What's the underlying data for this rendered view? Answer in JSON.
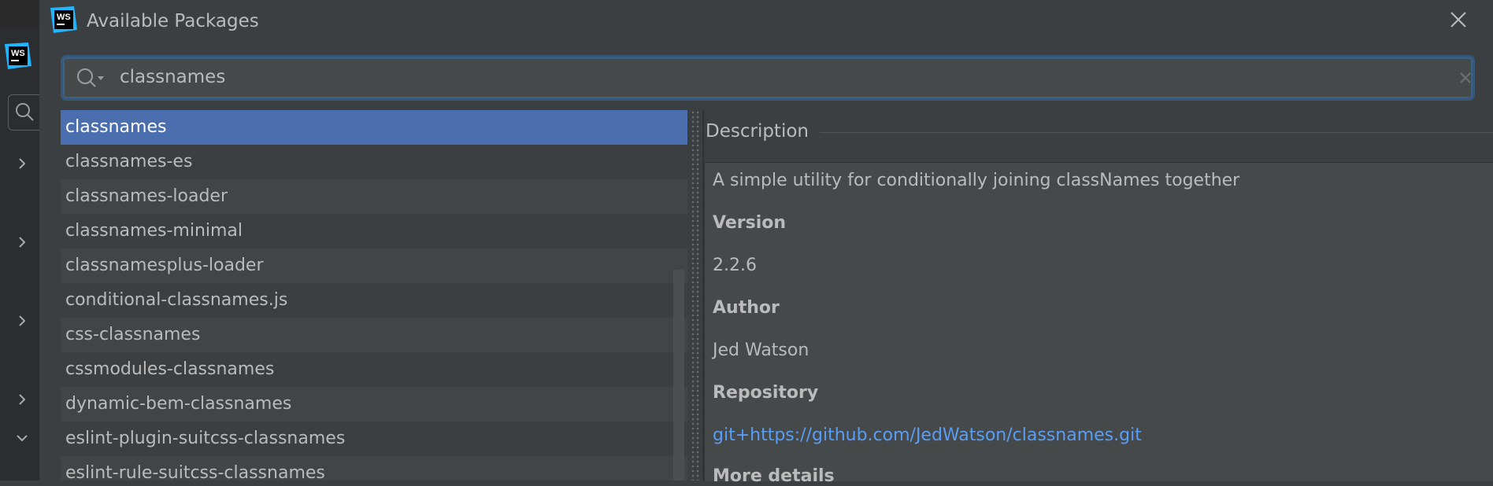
{
  "dialog": {
    "title": "Available Packages",
    "logo_text": "WS"
  },
  "search": {
    "value": "classnames"
  },
  "packages": [
    "classnames",
    "classnames-es",
    "classnames-loader",
    "classnames-minimal",
    "classnamesplus-loader",
    "conditional-classnames.js",
    "css-classnames",
    "cssmodules-classnames",
    "dynamic-bem-classnames",
    "eslint-plugin-suitcss-classnames",
    "eslint-rule-suitcss-classnames"
  ],
  "selected_index": 0,
  "details": {
    "header": "Description",
    "description": "A simple utility for conditionally joining classNames together",
    "version_label": "Version",
    "version": "2.2.6",
    "author_label": "Author",
    "author": "Jed Watson",
    "repository_label": "Repository",
    "repository": "git+https://github.com/JedWatson/classnames.git",
    "more_label": "More details"
  },
  "colors": {
    "accent": "#4b6eaf",
    "link": "#589df6",
    "background": "#3c3f41"
  }
}
